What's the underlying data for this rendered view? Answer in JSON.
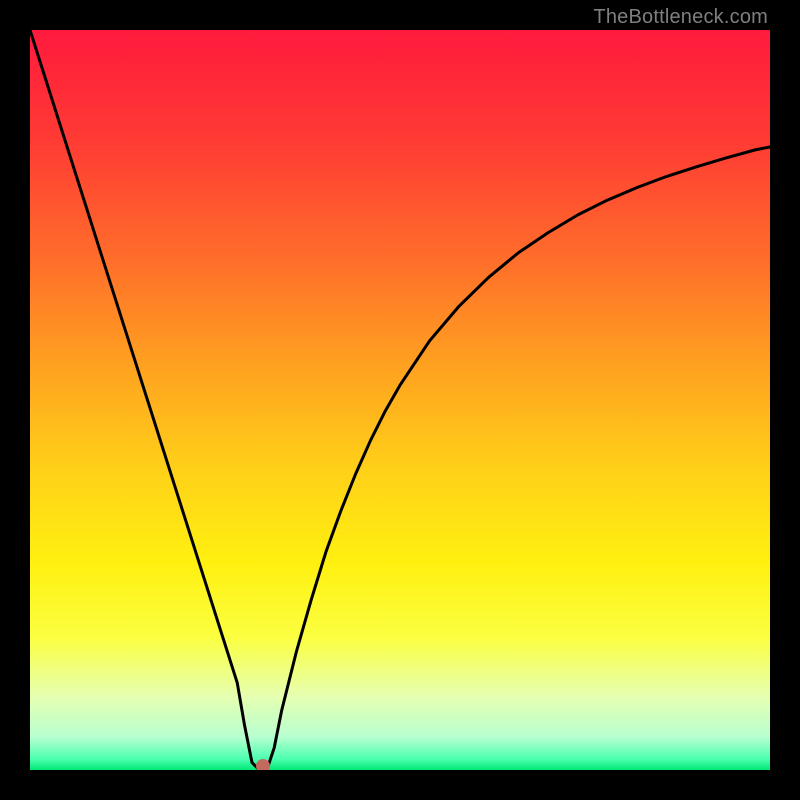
{
  "watermark": "TheBottleneck.com",
  "chart_data": {
    "type": "line",
    "title": "",
    "xlabel": "",
    "ylabel": "",
    "xlim": [
      0,
      100
    ],
    "ylim": [
      0,
      100
    ],
    "grid": false,
    "legend": false,
    "background_gradient": {
      "stops": [
        {
          "pos": 0.0,
          "color": "#ff1a3d"
        },
        {
          "pos": 0.15,
          "color": "#ff3b34"
        },
        {
          "pos": 0.3,
          "color": "#ff6a2b"
        },
        {
          "pos": 0.45,
          "color": "#ffa020"
        },
        {
          "pos": 0.6,
          "color": "#ffd218"
        },
        {
          "pos": 0.72,
          "color": "#fff010"
        },
        {
          "pos": 0.82,
          "color": "#fbff40"
        },
        {
          "pos": 0.9,
          "color": "#e6ffb0"
        },
        {
          "pos": 0.955,
          "color": "#b8ffd0"
        },
        {
          "pos": 0.985,
          "color": "#4dffb0"
        },
        {
          "pos": 1.0,
          "color": "#00e878"
        }
      ]
    },
    "series": [
      {
        "name": "bottleneck-curve",
        "color": "#000000",
        "x": [
          0,
          2,
          4,
          6,
          8,
          10,
          12,
          14,
          16,
          18,
          20,
          22,
          24,
          26,
          28,
          29,
          30,
          31,
          32,
          33,
          34,
          36,
          38,
          40,
          42,
          44,
          46,
          48,
          50,
          54,
          58,
          62,
          66,
          70,
          74,
          78,
          82,
          86,
          90,
          94,
          98,
          100
        ],
        "y": [
          100,
          93.7,
          87.4,
          81.1,
          74.8,
          68.5,
          62.2,
          55.9,
          49.6,
          43.3,
          37.0,
          30.7,
          24.4,
          18.1,
          11.8,
          6.0,
          1.0,
          0.0,
          0.0,
          3.0,
          8.0,
          16.0,
          23.0,
          29.5,
          35.0,
          40.0,
          44.5,
          48.5,
          52.0,
          58.0,
          62.7,
          66.6,
          69.9,
          72.6,
          75.0,
          77.0,
          78.7,
          80.2,
          81.5,
          82.7,
          83.8,
          84.2
        ]
      }
    ],
    "marker": {
      "name": "minimum-point",
      "x": 31.5,
      "y": 0.5,
      "color": "#c26a5e"
    }
  }
}
